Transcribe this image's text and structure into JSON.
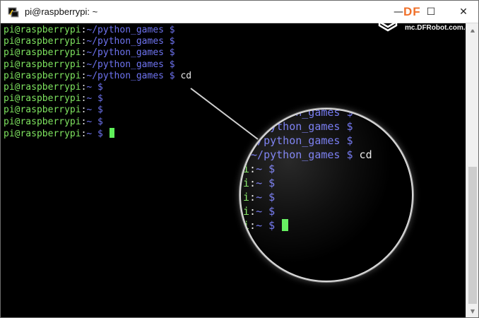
{
  "window": {
    "title": "pi@raspberrypi: ~",
    "minimize_glyph": "—",
    "maximize_glyph": "☐",
    "close_glyph": "✕",
    "app_icon": "putty-terminal-icon"
  },
  "watermark": {
    "logo_text": "DF",
    "url": "mc.DFRobot.com.cn"
  },
  "colors": {
    "user": "#7ee35f",
    "path": "#6e73f0",
    "cursor": "#5ff05a",
    "background": "#000000"
  },
  "terminal": {
    "lines": [
      {
        "user": "pi@raspberrypi",
        "sep": ":",
        "path": "~/python_games",
        "dollar": " $",
        "cmd": ""
      },
      {
        "user": "pi@raspberrypi",
        "sep": ":",
        "path": "~/python_games",
        "dollar": " $",
        "cmd": ""
      },
      {
        "user": "pi@raspberrypi",
        "sep": ":",
        "path": "~/python_games",
        "dollar": " $",
        "cmd": ""
      },
      {
        "user": "pi@raspberrypi",
        "sep": ":",
        "path": "~/python_games",
        "dollar": " $",
        "cmd": ""
      },
      {
        "user": "pi@raspberrypi",
        "sep": ":",
        "path": "~/python_games",
        "dollar": " $",
        "cmd": " cd"
      },
      {
        "user": "pi@raspberrypi",
        "sep": ":",
        "path": "~",
        "dollar": " $",
        "cmd": ""
      },
      {
        "user": "pi@raspberrypi",
        "sep": ":",
        "path": "~",
        "dollar": " $",
        "cmd": ""
      },
      {
        "user": "pi@raspberrypi",
        "sep": ":",
        "path": "~",
        "dollar": " $",
        "cmd": ""
      },
      {
        "user": "pi@raspberrypi",
        "sep": ":",
        "path": "~",
        "dollar": " $",
        "cmd": ""
      },
      {
        "user": "pi@raspberrypi",
        "sep": ":",
        "path": "~",
        "dollar": " $",
        "cmd": ""
      }
    ]
  },
  "magnifier": {
    "lines": [
      {
        "user": "",
        "sep": ":",
        "path": "~/python_games",
        "dollar": " $",
        "cmd": ""
      },
      {
        "user": "",
        "sep": ":",
        "path": "~/python_games",
        "dollar": " $",
        "cmd": ""
      },
      {
        "user": "",
        "sep": ":",
        "path": "~/python_games",
        "dollar": " $",
        "cmd": ""
      },
      {
        "user": "",
        "sep": ":",
        "path": "~/python_games",
        "dollar": " $",
        "cmd": " cd"
      },
      {
        "user": "i",
        "sep": ":",
        "path": "~",
        "dollar": " $",
        "cmd": ""
      },
      {
        "user": "i",
        "sep": ":",
        "path": "~",
        "dollar": " $",
        "cmd": ""
      },
      {
        "user": "i",
        "sep": ":",
        "path": "~",
        "dollar": " $",
        "cmd": ""
      },
      {
        "user": "i",
        "sep": ":",
        "path": "~",
        "dollar": " $",
        "cmd": ""
      },
      {
        "user": "i",
        "sep": ":",
        "path": "~",
        "dollar": " $",
        "cmd": ""
      }
    ]
  }
}
